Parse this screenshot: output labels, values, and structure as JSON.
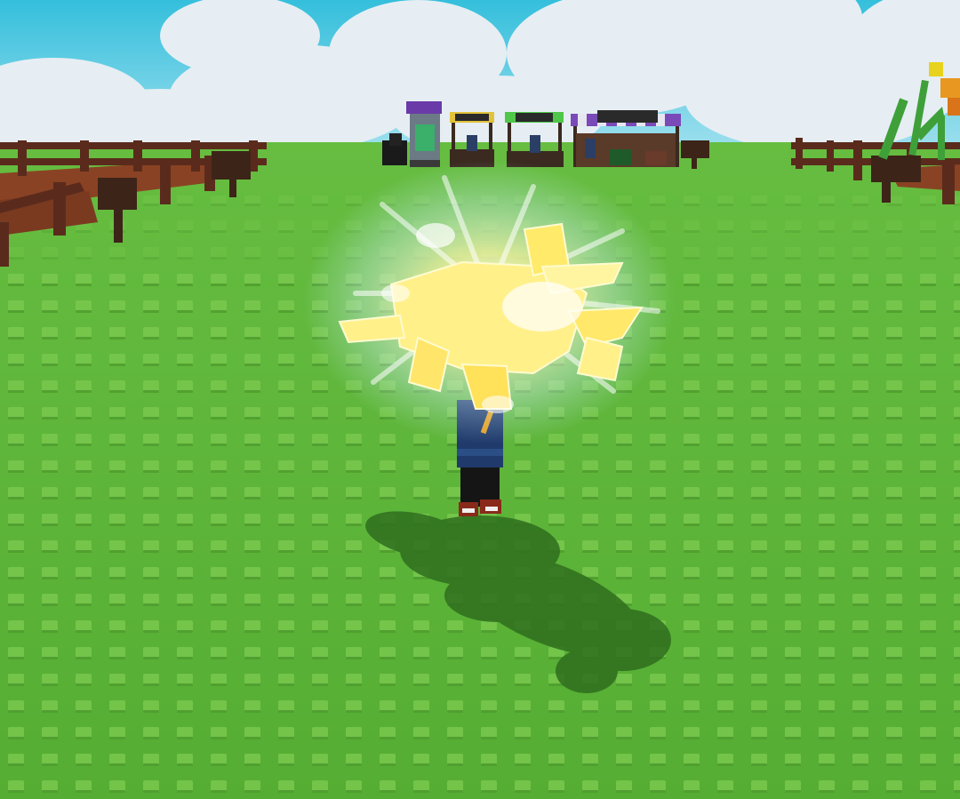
{
  "scene": {
    "colors": {
      "sky": "#3bc4de",
      "cloud": "#e6eef3",
      "grass": "#5cb338",
      "stud": "#7ac94f",
      "stud_dark": "#4e9c2e",
      "fence": "#5a2b1c",
      "fence_deck": "#8a4224",
      "glow": "#fff4a0",
      "shadow": "#2e6a1c",
      "character_shirt": "#1f3a6b",
      "character_pants": "#151515",
      "character_shoes": "#8a2a1a"
    },
    "icons": [
      "sparkle-burst-icon"
    ]
  }
}
